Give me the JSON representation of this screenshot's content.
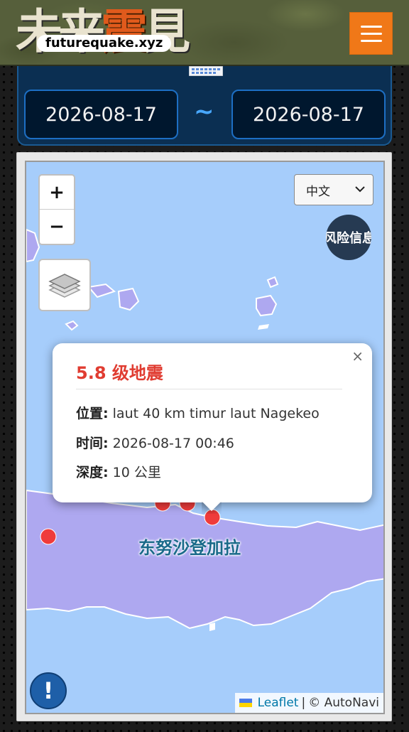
{
  "header": {
    "logo_chars": [
      "未",
      "来",
      "震",
      "見"
    ],
    "site_url": "futurequake.xyz",
    "menu_icon": "hamburger-icon"
  },
  "date_range": {
    "start": "2026-08-17",
    "separator": "~",
    "end": "2026-08-17",
    "icon": "calendar-icon"
  },
  "map": {
    "zoom_in": "+",
    "zoom_out": "−",
    "layers_icon": "layers-icon",
    "language_select": {
      "selected": "中文"
    },
    "risk_button": "风险信息",
    "info_button": "!",
    "region_label": "东努沙登加拉",
    "attribution": {
      "leaflet": "Leaflet",
      "separator": "|",
      "provider": "© AutoNavi"
    },
    "colors": {
      "sea": "#a6cdfb",
      "land": "#aea8f0",
      "marker": "#ef3b3b"
    }
  },
  "popup": {
    "title": "5.8 级地震",
    "close": "×",
    "location_label": "位置:",
    "location_value": "laut 40 km timur laut Nagekeo",
    "time_label": "时间:",
    "time_value": "2026-08-17 00:46",
    "depth_label": "深度:",
    "depth_value": "10 公里"
  }
}
